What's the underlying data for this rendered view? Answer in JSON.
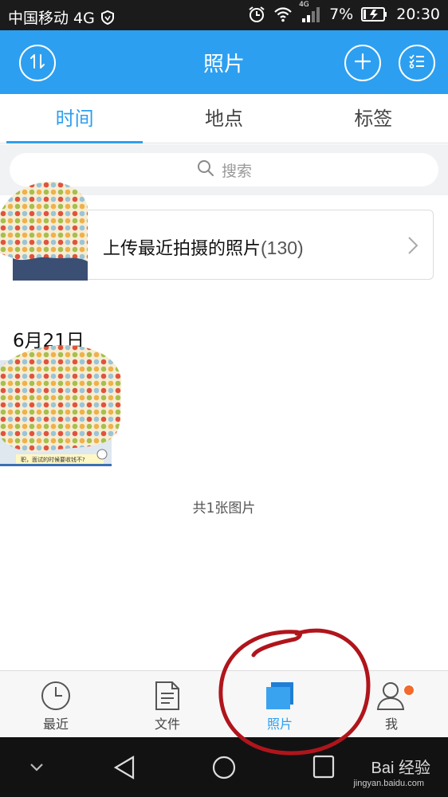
{
  "status_bar": {
    "carrier": "中国移动 4G",
    "network_badge": "4G",
    "battery": "7%",
    "time": "20:30"
  },
  "app_bar": {
    "title": "照片",
    "left_icon": "sort-icon",
    "right_icons": [
      "add-icon",
      "select-list-icon"
    ]
  },
  "tabs": [
    {
      "label": "时间",
      "active": true
    },
    {
      "label": "地点",
      "active": false
    },
    {
      "label": "标签",
      "active": false
    }
  ],
  "search": {
    "placeholder": "搜索"
  },
  "upload_card": {
    "label": "上传最近拍摄的照片",
    "count": "(130)"
  },
  "date_section": {
    "date": "6月21日",
    "thumbnail_caption": "职，面试的时候要收钱不?"
  },
  "photo_count": "共1张图片",
  "bottom_nav": [
    {
      "label": "最近",
      "icon": "clock-icon",
      "active": false
    },
    {
      "label": "文件",
      "icon": "file-icon",
      "active": false
    },
    {
      "label": "照片",
      "icon": "photo-icon",
      "active": true
    },
    {
      "label": "我",
      "icon": "person-icon",
      "active": false
    }
  ],
  "watermark": {
    "text": "Bai 经验",
    "sub": "jingyan.baidu.com"
  },
  "colors": {
    "accent": "#2d9ff0",
    "status_bar": "#1b1b1b",
    "system_nav": "#121212",
    "badge": "#f26a2c",
    "annotation": "#b0151c"
  }
}
